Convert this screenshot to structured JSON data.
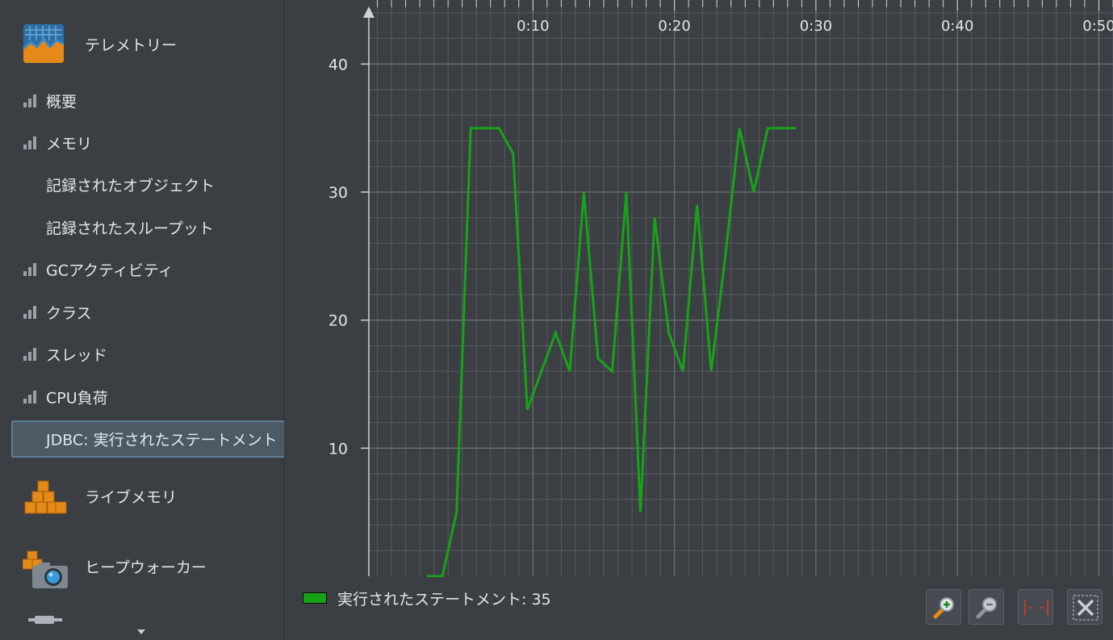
{
  "sidebar": {
    "telemetry_header": {
      "label": "テレメトリー",
      "icon": "telemetry-icon"
    },
    "items": [
      {
        "label": "概要",
        "icon": "bar-chart-icon"
      },
      {
        "label": "メモリ",
        "icon": "bar-chart-icon"
      },
      {
        "label": "記録されたオブジェクト",
        "icon": ""
      },
      {
        "label": "記録されたスループット",
        "icon": ""
      },
      {
        "label": "GCアクティビティ",
        "icon": "bar-chart-icon"
      },
      {
        "label": "クラス",
        "icon": "bar-chart-icon"
      },
      {
        "label": "スレッド",
        "icon": "bar-chart-icon"
      },
      {
        "label": "CPU負荷",
        "icon": "bar-chart-icon"
      },
      {
        "label": "JDBC: 実行されたステートメント",
        "icon": "",
        "selected": true
      }
    ],
    "live_memory_header": {
      "label": "ライブメモリ",
      "icon": "cubes-icon"
    },
    "heap_walker_header": {
      "label": "ヒープウォーカー",
      "icon": "camera-cubes-icon"
    }
  },
  "chart": {
    "legend_label": "実行されたステートメント: 35",
    "series_color": "#17a317",
    "grid_color": "#5e6267"
  },
  "toolbar": {
    "zoom_in": "zoom-in-icon",
    "zoom_out": "zoom-out-icon",
    "fit": "fit-width-icon",
    "reset": "reset-zoom-icon"
  },
  "chart_data": {
    "type": "line",
    "title": "",
    "xlabel": "",
    "ylabel": "",
    "x_unit": "seconds",
    "x_tick_labels": [
      "0:10",
      "0:20",
      "0:30",
      "0:40",
      "0:50"
    ],
    "x_ticks": [
      10,
      20,
      30,
      40,
      50
    ],
    "y_tick_labels": [
      "10",
      "20",
      "30",
      "40"
    ],
    "y_ticks": [
      10,
      20,
      30,
      40
    ],
    "xlim": [
      -1.6,
      51
    ],
    "ylim": [
      0,
      45
    ],
    "grid": true,
    "series": [
      {
        "name": "実行されたステートメント",
        "x": [
          2.5,
          3.6,
          4.6,
          5.6,
          6.6,
          7.6,
          8.6,
          9.6,
          10.6,
          11.6,
          12.6,
          13.6,
          14.6,
          15.6,
          16.6,
          17.6,
          18.6,
          19.6,
          20.6,
          21.6,
          22.6,
          23.6,
          24.6,
          25.6,
          26.6,
          27.6,
          28.6
        ],
        "y": [
          0,
          0,
          5,
          35,
          35,
          35,
          33,
          13,
          16,
          19,
          16,
          30,
          17,
          16,
          30,
          5,
          28,
          19,
          16,
          29,
          16,
          25,
          35,
          30,
          35,
          35,
          35
        ]
      }
    ]
  }
}
